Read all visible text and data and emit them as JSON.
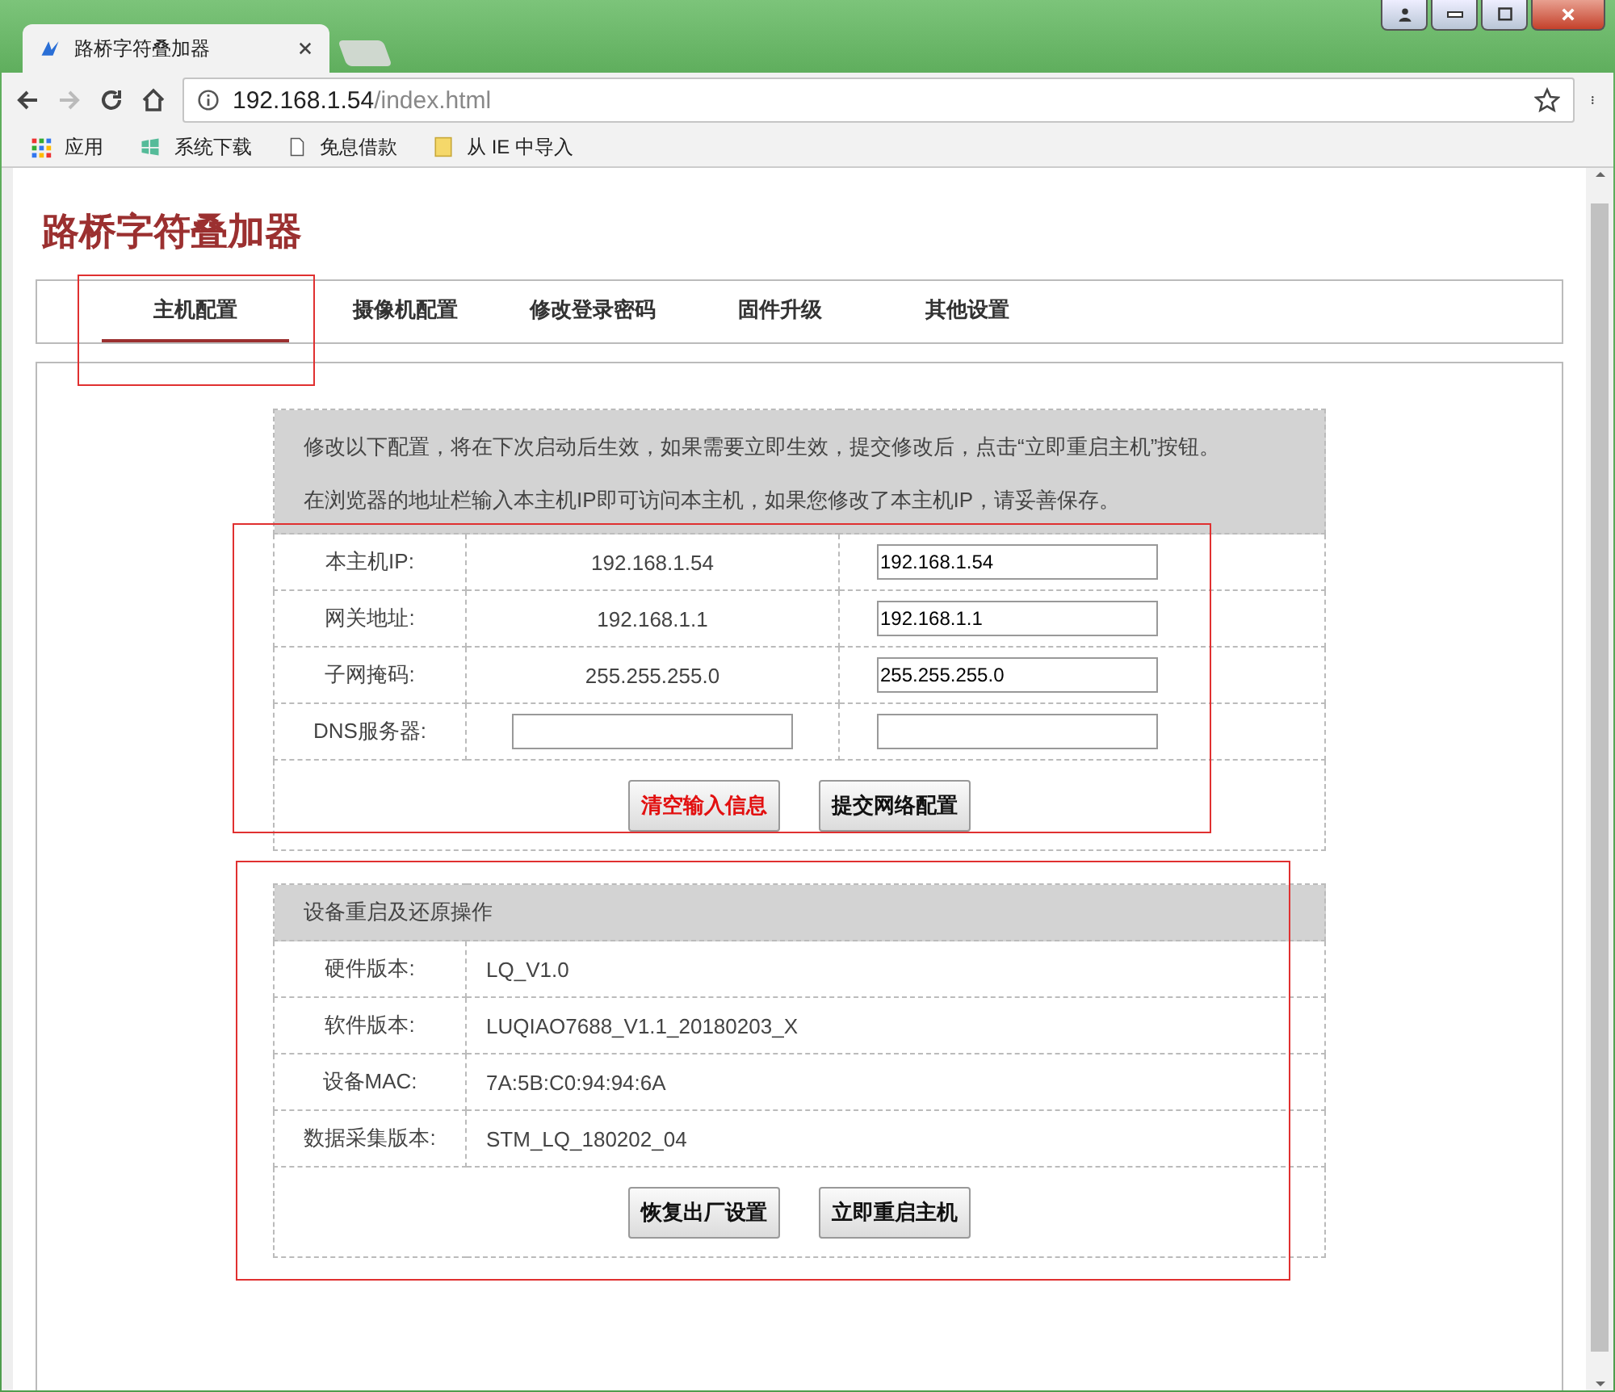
{
  "browser": {
    "tab_title": "路桥字符叠加器",
    "url_host": "192.168.1.54",
    "url_path": "/index.html",
    "bookmarks": [
      {
        "label": "应用",
        "kind": "apps"
      },
      {
        "label": "系统下载",
        "kind": "site"
      },
      {
        "label": "免息借款",
        "kind": "page"
      },
      {
        "label": "从 IE 中导入",
        "kind": "folder"
      }
    ]
  },
  "page": {
    "title": "路桥字符叠加器",
    "tabs": [
      {
        "label": "主机配置",
        "selected": true
      },
      {
        "label": "摄像机配置",
        "selected": false
      },
      {
        "label": "修改登录密码",
        "selected": false
      },
      {
        "label": "固件升级",
        "selected": false
      },
      {
        "label": "其他设置",
        "selected": false
      }
    ],
    "network": {
      "notes": [
        "修改以下配置，将在下次启动后生效，如果需要立即生效，提交修改后，点击“立即重启主机”按钮。",
        "在浏览器的地址栏输入本主机IP即可访问本主机，如果您修改了本主机IP，请妥善保存。"
      ],
      "rows": [
        {
          "kind": "text",
          "label": "本主机IP:",
          "current": "192.168.1.54",
          "value": "192.168.1.54"
        },
        {
          "kind": "text",
          "label": "网关地址:",
          "current": "192.168.1.1",
          "value": "192.168.1.1"
        },
        {
          "kind": "text",
          "label": "子网掩码:",
          "current": "255.255.255.0",
          "value": "255.255.255.0"
        },
        {
          "kind": "input",
          "label": "DNS服务器:"
        }
      ],
      "buttons": [
        {
          "label": "清空输入信息",
          "kind": "danger"
        },
        {
          "label": "提交网络配置",
          "kind": "normal"
        }
      ]
    },
    "device": {
      "heading": "设备重启及还原操作",
      "rows": [
        {
          "label": "硬件版本:",
          "value": "LQ_V1.0"
        },
        {
          "label": "软件版本:",
          "value": "LUQIAO7688_V1.1_20180203_X"
        },
        {
          "label": "设备MAC:",
          "value": "7A:5B:C0:94:94:6A"
        },
        {
          "label": "数据采集版本:",
          "value": "STM_LQ_180202_04"
        }
      ],
      "buttons": [
        {
          "label": "恢复出厂设置",
          "kind": "normal"
        },
        {
          "label": "立即重启主机",
          "kind": "normal"
        }
      ]
    }
  }
}
